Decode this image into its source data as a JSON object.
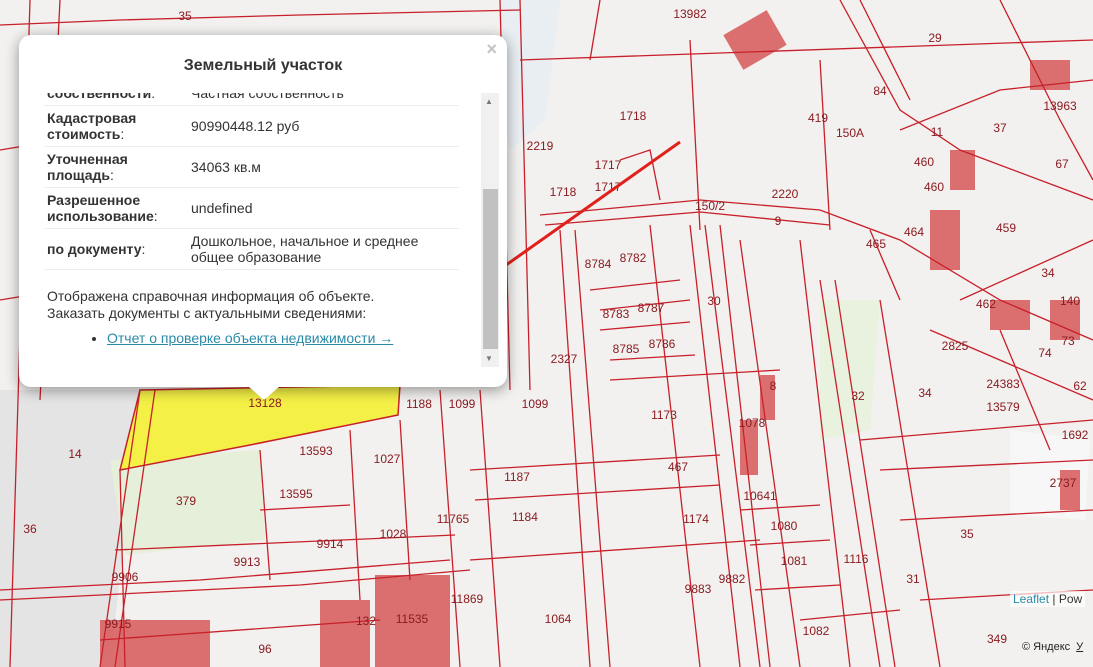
{
  "map": {
    "parcel_labels": [
      "35",
      "13982",
      "29",
      "1718",
      "419",
      "37",
      "1717",
      "1717",
      "1718",
      "2219",
      "2220",
      "9",
      "150/2",
      "150A",
      "11",
      "460",
      "460",
      "464",
      "465",
      "459",
      "34",
      "462",
      "8784",
      "8782",
      "8783",
      "8787",
      "8785",
      "8786",
      "30",
      "2327",
      "1173",
      "1078",
      "8",
      "32",
      "34",
      "24383",
      "13579",
      "62",
      "1692",
      "2737",
      "35",
      "31",
      "349",
      "1082",
      "1081",
      "1080",
      "10641",
      "1174",
      "467",
      "1187",
      "1184",
      "1064",
      "9883",
      "9882",
      "1116",
      "13128",
      "13593",
      "1027",
      "379",
      "13595",
      "1028",
      "9913",
      "9914",
      "9906",
      "9915",
      "96",
      "132",
      "11535",
      "11765",
      "11869",
      "1188",
      "1099",
      "14",
      "36",
      "84",
      "13963",
      "67",
      "73",
      "74",
      "140",
      "2825",
      "1099"
    ],
    "colors": {
      "parcel_border": "#c8202a",
      "highlight": "#f4f046",
      "building": "#d96060",
      "arrow": "#e0201a"
    }
  },
  "popup": {
    "title": "Земельный участок",
    "close_label": "×",
    "rows": [
      {
        "key": "собственности",
        "value": "Частная собственность"
      },
      {
        "key": "Кадастровая стоимость",
        "value": "90990448.12 руб"
      },
      {
        "key": "Уточненная площадь",
        "value": "34063 кв.м"
      },
      {
        "key": "Разрешенное использование",
        "value": "undefined"
      },
      {
        "key": "по документу",
        "value": "Дошкольное, начальное и среднее общее образование"
      }
    ],
    "note_line1": "Отображена справочная информация об объекте.",
    "note_line2": "Заказать документы с актуальными сведениями:",
    "link": "Отчет о проверке объекта недвижимости →"
  },
  "attribution": {
    "leaflet": "Leaflet",
    "sep": " | ",
    "powered": "Pow",
    "yandex": "© Яндекс",
    "yandex_link": "У"
  }
}
